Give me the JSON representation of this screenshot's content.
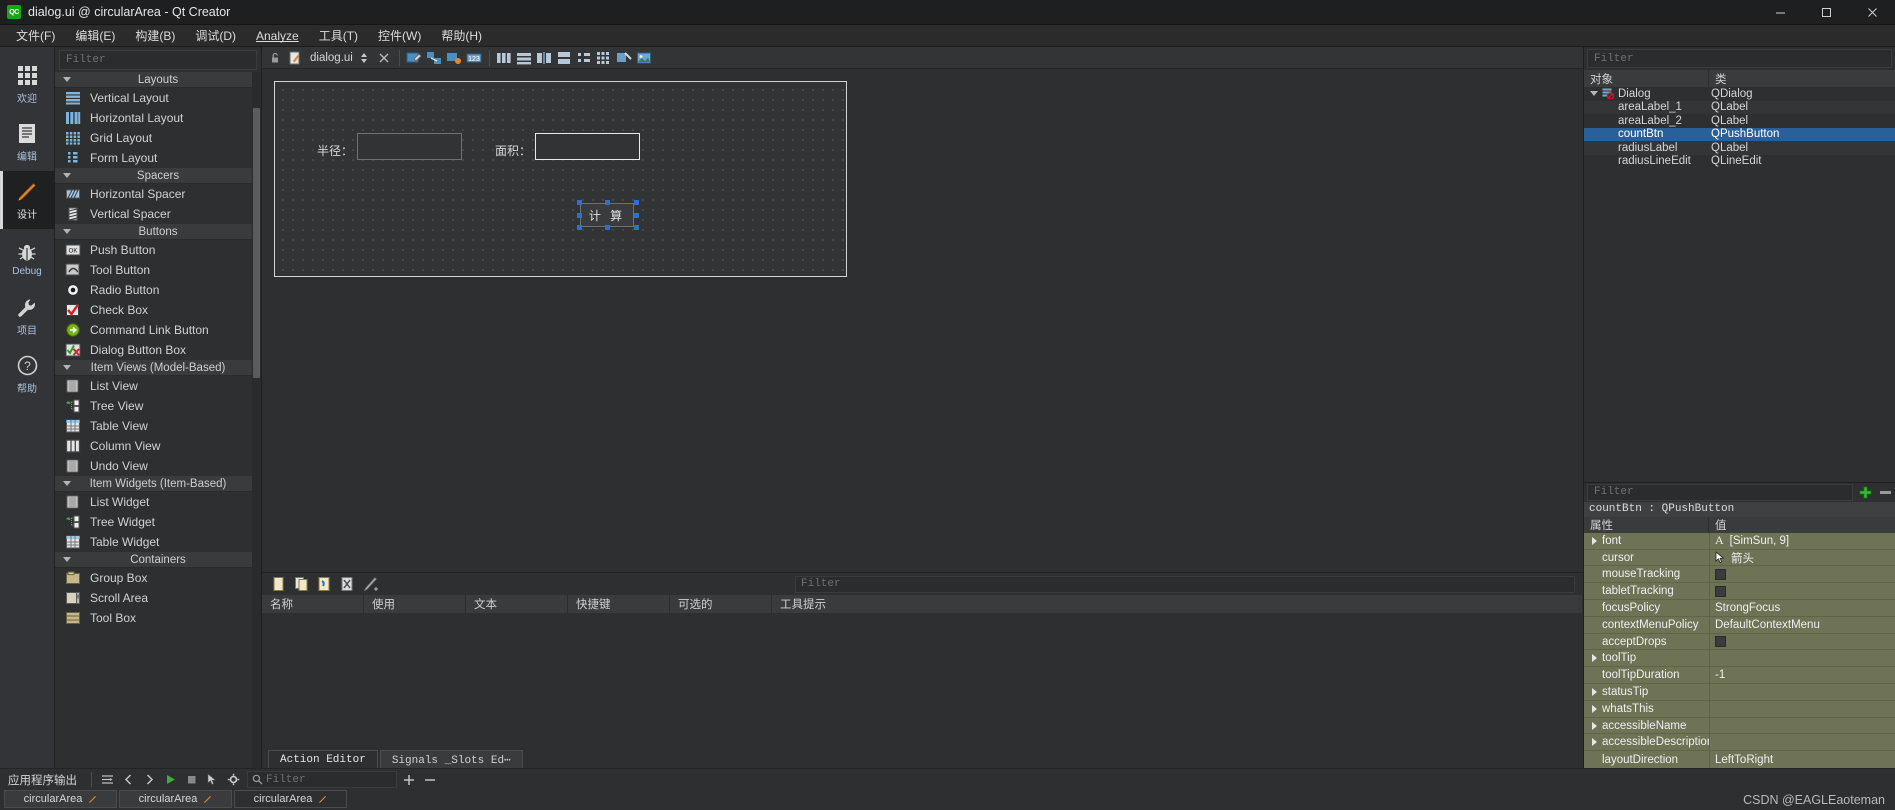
{
  "window": {
    "title": "dialog.ui @ circularArea - Qt Creator",
    "logo_text": "QC",
    "minimize": "minimize-icon",
    "maximize": "maximize-icon",
    "close": "close-icon"
  },
  "menubar": [
    {
      "label": "文件(F)",
      "mnemonic": "F"
    },
    {
      "label": "编辑(E)",
      "mnemonic": "E"
    },
    {
      "label": "构建(B)",
      "mnemonic": "B"
    },
    {
      "label": "调试(D)",
      "mnemonic": "D"
    },
    {
      "label": "Analyze",
      "mnemonic": "A"
    },
    {
      "label": "工具(T)",
      "mnemonic": "T"
    },
    {
      "label": "控件(W)",
      "mnemonic": "W"
    },
    {
      "label": "帮助(H)",
      "mnemonic": "H"
    }
  ],
  "modebar": [
    {
      "label": "欢迎",
      "icon": "grid-icon",
      "active": false
    },
    {
      "label": "编辑",
      "icon": "document-icon",
      "active": false
    },
    {
      "label": "设计",
      "icon": "pencil-icon",
      "active": true
    },
    {
      "label": "Debug",
      "icon": "bug-icon",
      "active": false
    },
    {
      "label": "项目",
      "icon": "wrench-icon",
      "active": false
    },
    {
      "label": "帮助",
      "icon": "question-icon",
      "active": false
    }
  ],
  "editor_toolbar": {
    "filename": "dialog.ui",
    "lock_icon": "unlock-icon",
    "file_icon": "ui-file-icon",
    "split_icon": "split-icon",
    "close_icon": "close-editor-icon",
    "tools": [
      "edit-widgets-icon",
      "edit-signals-icon",
      "edit-buddies-icon",
      "edit-tab-order-icon",
      "layout-horizontal-icon",
      "layout-vertical-icon",
      "layout-splitter-h-icon",
      "layout-splitter-v-icon",
      "layout-form-icon",
      "layout-grid-icon",
      "break-layout-icon",
      "adjust-size-icon"
    ]
  },
  "widgetbox": {
    "filter_placeholder": "Filter",
    "categories": [
      {
        "title": "Layouts",
        "items": [
          {
            "label": "Vertical Layout",
            "icon": "vertical-layout-icon"
          },
          {
            "label": "Horizontal Layout",
            "icon": "horizontal-layout-icon"
          },
          {
            "label": "Grid Layout",
            "icon": "grid-layout-icon"
          },
          {
            "label": "Form Layout",
            "icon": "form-layout-icon"
          }
        ]
      },
      {
        "title": "Spacers",
        "items": [
          {
            "label": "Horizontal Spacer",
            "icon": "horizontal-spacer-icon"
          },
          {
            "label": "Vertical Spacer",
            "icon": "vertical-spacer-icon"
          }
        ]
      },
      {
        "title": "Buttons",
        "items": [
          {
            "label": "Push Button",
            "icon": "push-button-icon"
          },
          {
            "label": "Tool Button",
            "icon": "tool-button-icon"
          },
          {
            "label": "Radio Button",
            "icon": "radio-button-icon"
          },
          {
            "label": "Check Box",
            "icon": "check-box-icon"
          },
          {
            "label": "Command Link Button",
            "icon": "command-link-icon"
          },
          {
            "label": "Dialog Button Box",
            "icon": "dialog-button-box-icon"
          }
        ]
      },
      {
        "title": "Item Views (Model-Based)",
        "items": [
          {
            "label": "List View",
            "icon": "list-view-icon"
          },
          {
            "label": "Tree View",
            "icon": "tree-view-icon"
          },
          {
            "label": "Table View",
            "icon": "table-view-icon"
          },
          {
            "label": "Column View",
            "icon": "column-view-icon"
          },
          {
            "label": "Undo View",
            "icon": "undo-view-icon"
          }
        ]
      },
      {
        "title": "Item Widgets (Item-Based)",
        "items": [
          {
            "label": "List Widget",
            "icon": "list-widget-icon"
          },
          {
            "label": "Tree Widget",
            "icon": "tree-widget-icon"
          },
          {
            "label": "Table Widget",
            "icon": "table-widget-icon"
          }
        ]
      },
      {
        "title": "Containers",
        "items": [
          {
            "label": "Group Box",
            "icon": "group-box-icon"
          },
          {
            "label": "Scroll Area",
            "icon": "scroll-area-icon"
          },
          {
            "label": "Tool Box",
            "icon": "tool-box-icon"
          }
        ]
      }
    ]
  },
  "form": {
    "radius_label": "半径：",
    "area_label": "面积：",
    "button_label": "计 算"
  },
  "action_editor": {
    "filter_placeholder": "Filter",
    "columns": [
      "名称",
      "使用",
      "文本",
      "快捷键",
      "可选的",
      "工具提示"
    ],
    "rows": [],
    "toolbar_icons": [
      "new-action-icon",
      "copy-action-icon",
      "paste-action-icon",
      "delete-action-icon",
      "edit-action-icon"
    ],
    "tabs": [
      {
        "label": "Action Editor",
        "active": true
      },
      {
        "label": "Signals _Slots Ed⋯",
        "active": false
      }
    ]
  },
  "object_inspector": {
    "filter_placeholder": "Filter",
    "columns": [
      "对象",
      "类"
    ],
    "rows": [
      {
        "name": "Dialog",
        "class": "QDialog",
        "level": 0,
        "icon": "dialog-icon",
        "selected": false,
        "expanded": true
      },
      {
        "name": "areaLabel_1",
        "class": "QLabel",
        "level": 1,
        "icon": "",
        "selected": false
      },
      {
        "name": "areaLabel_2",
        "class": "QLabel",
        "level": 1,
        "icon": "",
        "selected": false
      },
      {
        "name": "countBtn",
        "class": "QPushButton",
        "level": 1,
        "icon": "",
        "selected": true
      },
      {
        "name": "radiusLabel",
        "class": "QLabel",
        "level": 1,
        "icon": "",
        "selected": false
      },
      {
        "name": "radiusLineEdit",
        "class": "QLineEdit",
        "level": 1,
        "icon": "",
        "selected": false
      }
    ]
  },
  "property_editor": {
    "filter_placeholder": "Filter",
    "add_icon": "plus-icon",
    "remove_icon": "minus-icon",
    "object_line": "countBtn : QPushButton",
    "columns": [
      "属性",
      "值"
    ],
    "rows": [
      {
        "name": "font",
        "value": "[SimSun, 9]",
        "expandable": true,
        "value_icon": "font-A-icon",
        "type": "text"
      },
      {
        "name": "cursor",
        "value": "箭头",
        "expandable": false,
        "value_icon": "cursor-arrow-icon",
        "type": "text"
      },
      {
        "name": "mouseTracking",
        "value": "",
        "expandable": false,
        "type": "checkbox",
        "checked": false
      },
      {
        "name": "tabletTracking",
        "value": "",
        "expandable": false,
        "type": "checkbox",
        "checked": false
      },
      {
        "name": "focusPolicy",
        "value": "StrongFocus",
        "expandable": false,
        "type": "text"
      },
      {
        "name": "contextMenuPolicy",
        "value": "DefaultContextMenu",
        "expandable": false,
        "type": "text"
      },
      {
        "name": "acceptDrops",
        "value": "",
        "expandable": false,
        "type": "checkbox",
        "checked": false
      },
      {
        "name": "toolTip",
        "value": "",
        "expandable": true,
        "type": "text"
      },
      {
        "name": "toolTipDuration",
        "value": "-1",
        "expandable": false,
        "type": "text"
      },
      {
        "name": "statusTip",
        "value": "",
        "expandable": true,
        "type": "text"
      },
      {
        "name": "whatsThis",
        "value": "",
        "expandable": true,
        "type": "text"
      },
      {
        "name": "accessibleName",
        "value": "",
        "expandable": true,
        "type": "text"
      },
      {
        "name": "accessibleDescription",
        "value": "",
        "expandable": true,
        "type": "text"
      },
      {
        "name": "layoutDirection",
        "value": "LeftToRight",
        "expandable": false,
        "type": "text"
      }
    ]
  },
  "output_bar": {
    "label": "应用程序输出",
    "filter_placeholder": "Filter",
    "icons": [
      "wordwrap-icon",
      "prev-icon",
      "next-icon",
      "run-icon",
      "stop-icon",
      "pointer-icon",
      "gear-icon",
      "search-icon",
      "plus-icon",
      "minus-icon"
    ]
  },
  "project_tabs": [
    {
      "label": "circularArea",
      "active": false,
      "icon": "pencil-small-icon"
    },
    {
      "label": "circularArea",
      "active": false,
      "icon": "pencil-small-icon"
    },
    {
      "label": "circularArea",
      "active": true,
      "icon": "pencil-small-icon"
    }
  ],
  "watermark": "CSDN @EAGLEaoteman",
  "colors": {
    "selection_blue": "#2a6099",
    "property_olive": "#6e7356",
    "handle_blue": "#2f6fd0",
    "accent_orange": "#e8862a"
  }
}
